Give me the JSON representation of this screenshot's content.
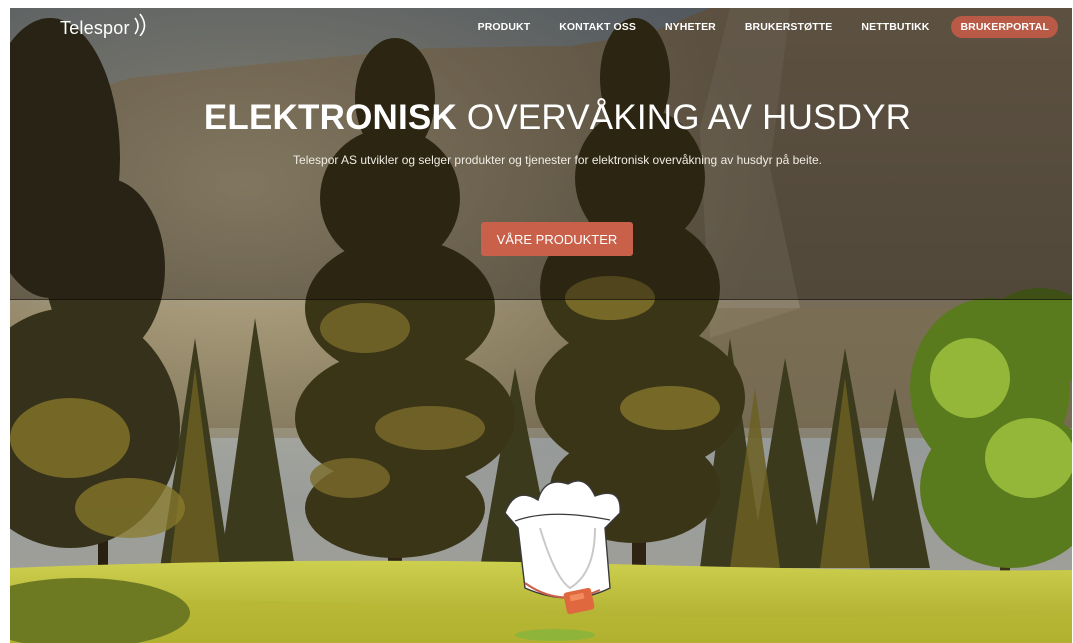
{
  "brand": {
    "name": "Telespor"
  },
  "nav": {
    "items": [
      {
        "label": "PRODUKT"
      },
      {
        "label": "KONTAKT OSS"
      },
      {
        "label": "NYHETER"
      },
      {
        "label": "BRUKERSTØTTE"
      },
      {
        "label": "NETTBUTIKK"
      },
      {
        "label": "BRUKERPORTAL"
      }
    ]
  },
  "hero": {
    "title_strong": "ELEKTRONISK",
    "title_light": "OVERVÅKING AV HUSDYR",
    "subtitle": "Telespor AS utvikler og selger produkter og tjenester for elektronisk overvåkning av husdyr på beite.",
    "button_label": "VÅRE PRODUKTER"
  },
  "colors": {
    "accent": "#c9604a",
    "portal_pill": "#b85a45"
  },
  "icons": {
    "logo_mark": "signal-arcs-icon",
    "mascot": "sheep-collar-mascot"
  }
}
